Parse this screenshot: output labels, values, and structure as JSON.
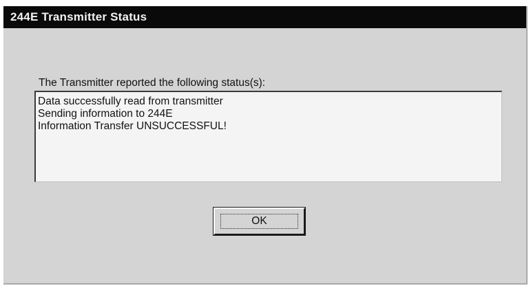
{
  "window": {
    "title": "244E Transmitter Status"
  },
  "dialog": {
    "prompt": "The Transmitter reported the following status(s):",
    "status_lines": [
      "Data successfully read from transmitter",
      "Sending information to 244E",
      "Information Transfer UNSUCCESSFUL!"
    ],
    "ok_label": "OK"
  },
  "colors": {
    "titlebar": "#0a0a0a",
    "dialog_background": "#d4d4d4",
    "status_box_background": "#f4f4f4"
  }
}
